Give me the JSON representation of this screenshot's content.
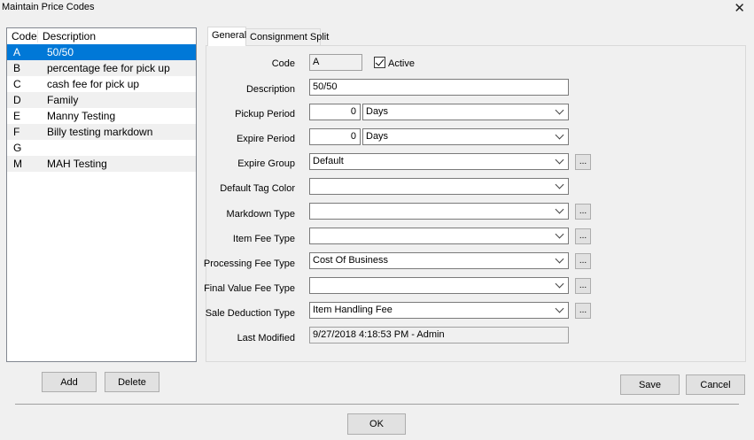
{
  "window": {
    "title": "Maintain Price Codes",
    "close_glyph": "✕"
  },
  "list": {
    "headers": {
      "code": "Code",
      "description": "Description"
    },
    "rows": [
      {
        "code": "A",
        "description": "50/50"
      },
      {
        "code": "B",
        "description": "percentage fee for pick up"
      },
      {
        "code": "C",
        "description": "cash fee for pick up"
      },
      {
        "code": "D",
        "description": "Family"
      },
      {
        "code": "E",
        "description": "Manny Testing"
      },
      {
        "code": "F",
        "description": "Billy testing markdown"
      },
      {
        "code": "G",
        "description": ""
      },
      {
        "code": "M",
        "description": "MAH Testing"
      }
    ],
    "selected_index": 0
  },
  "tabs": [
    {
      "label": "General"
    },
    {
      "label": "Consignment Split"
    }
  ],
  "form": {
    "code": {
      "label": "Code",
      "value": "A"
    },
    "active": {
      "label": "Active",
      "checked": true
    },
    "description": {
      "label": "Description",
      "value": "50/50"
    },
    "pickup_period": {
      "label": "Pickup Period",
      "value": "0",
      "unit": "Days"
    },
    "expire_period": {
      "label": "Expire Period",
      "value": "0",
      "unit": "Days"
    },
    "expire_group": {
      "label": "Expire Group",
      "value": "Default"
    },
    "default_tag_color": {
      "label": "Default Tag Color",
      "value": ""
    },
    "markdown_type": {
      "label": "Markdown Type",
      "value": ""
    },
    "item_fee_type": {
      "label": "Item Fee Type",
      "value": ""
    },
    "processing_fee_type": {
      "label": "Processing Fee Type",
      "value": "Cost Of Business"
    },
    "final_value_fee_type": {
      "label": "Final Value Fee Type",
      "value": ""
    },
    "sale_deduction_type": {
      "label": "Sale Deduction Type",
      "value": "Item Handling Fee"
    },
    "last_modified": {
      "label": "Last Modified",
      "value": "9/27/2018 4:18:53 PM - Admin"
    },
    "ellipsis": "..."
  },
  "buttons": {
    "add": "Add",
    "delete": "Delete",
    "save": "Save",
    "cancel": "Cancel",
    "ok": "OK"
  },
  "colors": {
    "selection": "#0078d7",
    "background": "#f0f0f0"
  }
}
